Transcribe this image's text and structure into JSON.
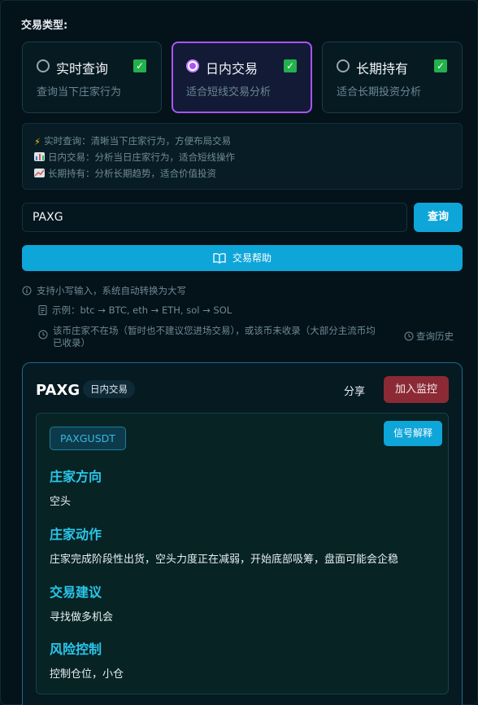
{
  "type_label": "交易类型:",
  "cards": [
    {
      "title": "实时查询",
      "subtitle": "查询当下庄家行为",
      "selected": false,
      "checked": true
    },
    {
      "title": "日内交易",
      "subtitle": "适合短线交易分析",
      "selected": true,
      "checked": true
    },
    {
      "title": "长期持有",
      "subtitle": "适合长期投资分析",
      "selected": false,
      "checked": true
    }
  ],
  "info": [
    {
      "icon": "lightning-icon",
      "text": "实时查询：清晰当下庄家行为，方便布局交易"
    },
    {
      "icon": "bar-chart-icon",
      "text": "日内交易：分析当日庄家行为，适合短线操作"
    },
    {
      "icon": "trend-chart-icon",
      "text": "长期持有：分析长期趋势，适合价值投资"
    }
  ],
  "search": {
    "value": "PAXG",
    "button": "查询"
  },
  "help_button": "交易帮助",
  "tips": {
    "line1": "支持小写输入，系统自动转换为大写",
    "line2": "示例：btc → BTC, eth → ETH, sol → SOL",
    "line3a": "该币庄家不在场（暂时也不建议您进场交易），或该币未收录（大部分主流币均",
    "line3b": "已收录）",
    "history": "查询历史"
  },
  "result": {
    "symbol": "PAXG",
    "badge": "日内交易",
    "share": "分享",
    "monitor": "加入监控",
    "pair": "PAXGUSDT",
    "explain": "信号解释",
    "sections": [
      {
        "title": "庄家方向",
        "text": "空头"
      },
      {
        "title": "庄家动作",
        "text": "庄家完成阶段性出货，空头力度正在减弱，开始底部吸筹，盘面可能会企稳"
      },
      {
        "title": "交易建议",
        "text": "寻找做多机会"
      },
      {
        "title": "风险控制",
        "text": "控制仓位，小仓"
      }
    ]
  },
  "colors": {
    "accent": "#0ea5d9",
    "selected_border": "#a855f7",
    "danger": "#8b2a35",
    "section_title": "#2bc6ea"
  }
}
